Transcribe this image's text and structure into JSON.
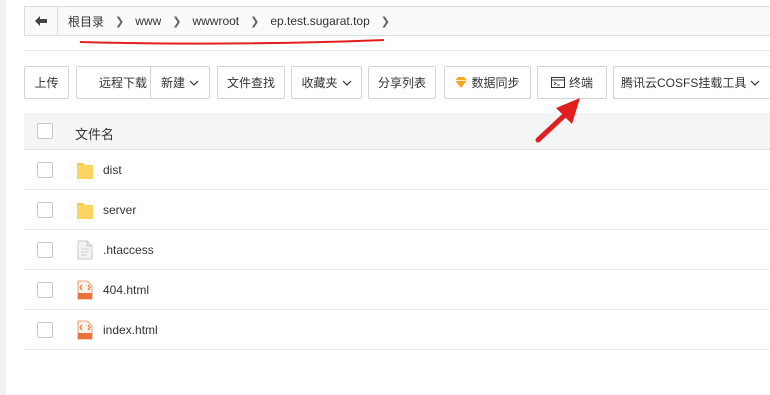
{
  "breadcrumb": {
    "items": [
      "根目录",
      "www",
      "wwwroot",
      "ep.test.sugarat.top"
    ]
  },
  "toolbar": {
    "upload": "上传",
    "remote_download": "远程下载",
    "new": "新建",
    "file_search": "文件查找",
    "favorites": "收藏夹",
    "share_list": "分享列表",
    "data_sync": "数据同步",
    "terminal": "终端",
    "cosfs": "腾讯云COSFS挂载工具"
  },
  "file_list": {
    "header": "文件名",
    "files": [
      {
        "name": "dist",
        "type": "folder"
      },
      {
        "name": "server",
        "type": "folder"
      },
      {
        "name": ".htaccess",
        "type": "file"
      },
      {
        "name": "404.html",
        "type": "html"
      },
      {
        "name": "index.html",
        "type": "html"
      }
    ]
  },
  "colors": {
    "annotation_red": "#e02020",
    "folder_yellow": "#f7c744",
    "html_orange": "#e8733a",
    "gem_orange": "#f5a623"
  },
  "icons": {
    "back": "back-arrow-icon",
    "folder": "folder-icon",
    "file": "file-icon",
    "html": "html-file-icon",
    "terminal": "terminal-icon",
    "gem": "diamond-icon"
  }
}
